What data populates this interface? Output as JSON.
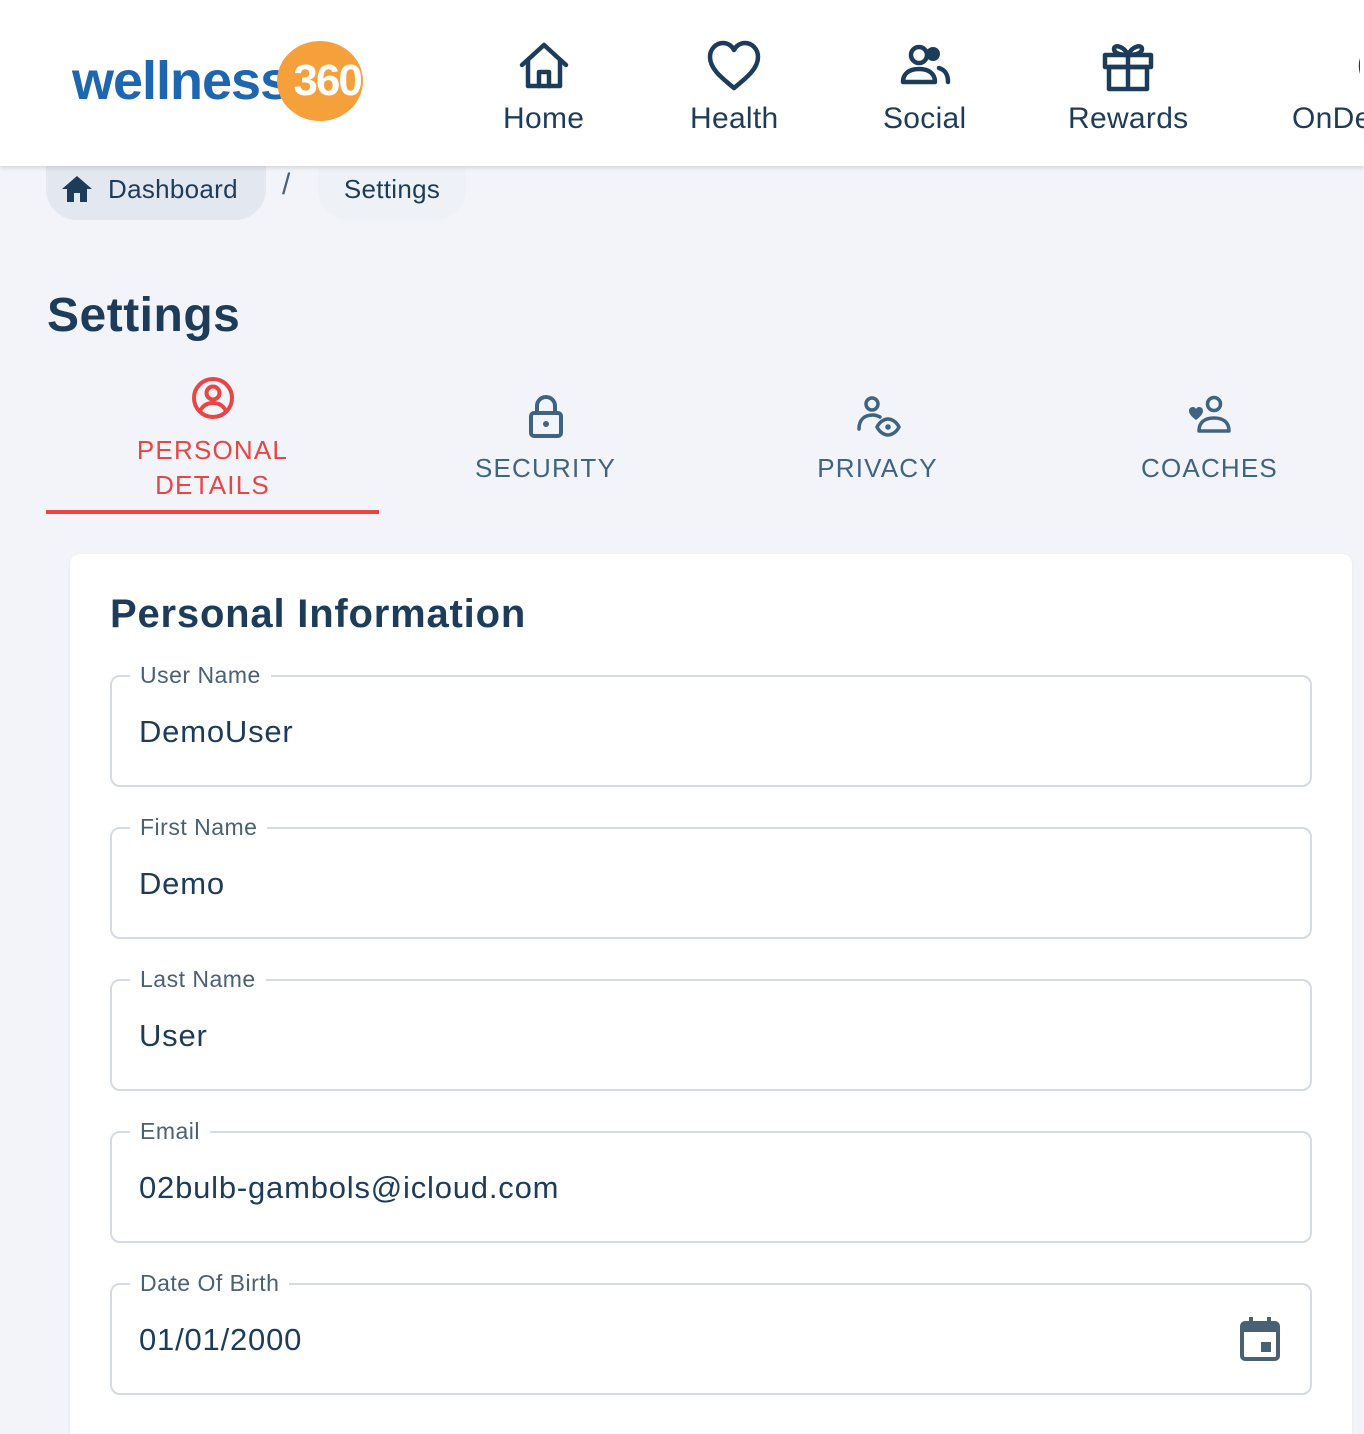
{
  "header": {
    "logo": {
      "text": "wellness",
      "number": "360"
    },
    "nav": [
      {
        "label": "Home",
        "icon": "home-icon"
      },
      {
        "label": "Health",
        "icon": "heart-icon"
      },
      {
        "label": "Social",
        "icon": "people-icon"
      },
      {
        "label": "Rewards",
        "icon": "gift-icon"
      },
      {
        "label": "OnDe",
        "icon": "circle-icon"
      }
    ]
  },
  "breadcrumb": {
    "home": "Dashboard",
    "separator": "/",
    "current": "Settings"
  },
  "page": {
    "title": "Settings"
  },
  "tabs": [
    {
      "label": "PERSONAL DETAILS",
      "icon": "account-circle-icon",
      "active": true
    },
    {
      "label": "SECURITY",
      "icon": "lock-icon",
      "active": false
    },
    {
      "label": "PRIVACY",
      "icon": "user-eye-icon",
      "active": false
    },
    {
      "label": "COACHES",
      "icon": "user-heart-icon",
      "active": false
    }
  ],
  "form": {
    "title": "Personal Information",
    "fields": [
      {
        "label": "User Name",
        "value": "DemoUser"
      },
      {
        "label": "First Name",
        "value": "Demo"
      },
      {
        "label": "Last Name",
        "value": "User"
      },
      {
        "label": "Email",
        "value": "02bulb-gambols@icloud.com"
      },
      {
        "label": "Date Of Birth",
        "value": "01/01/2000",
        "icon": "calendar-icon"
      }
    ]
  },
  "colors": {
    "primary": "#1d3c5a",
    "accent": "#e84545",
    "logo_blue": "#1f66b0",
    "logo_orange": "#f6a03c",
    "background": "#f2f4f9"
  }
}
